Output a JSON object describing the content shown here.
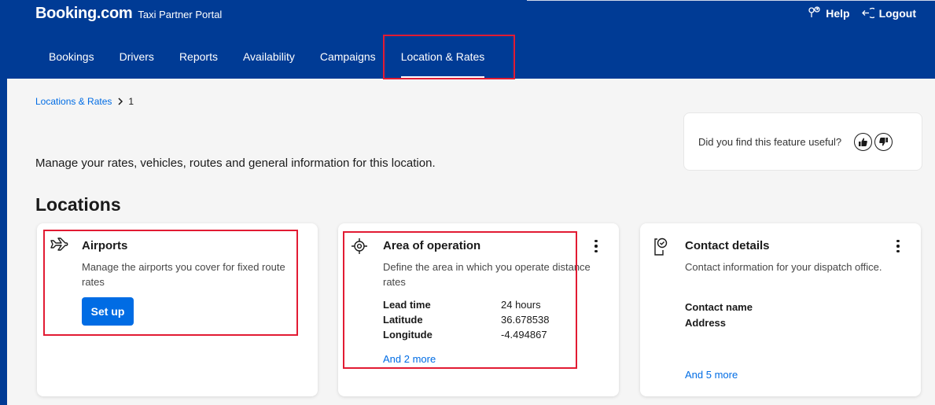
{
  "header": {
    "brand": "Booking.com",
    "portal": "Taxi Partner Portal",
    "help": "Help",
    "logout": "Logout"
  },
  "nav": {
    "tabs": [
      "Bookings",
      "Drivers",
      "Reports",
      "Availability",
      "Campaigns",
      "Location & Rates"
    ],
    "active": "Location & Rates"
  },
  "breadcrumb": {
    "link": "Locations & Rates",
    "current": "1"
  },
  "feedback": {
    "question": "Did you find this feature useful?"
  },
  "intro": "Manage your rates, vehicles, routes and general information for this location.",
  "section_title": "Locations",
  "cards": {
    "airports": {
      "title": "Airports",
      "description": "Manage the airports you cover for fixed route rates",
      "button": "Set up"
    },
    "area": {
      "title": "Area of operation",
      "description": "Define the area in which you operate distance rates",
      "fields": [
        {
          "label": "Lead time",
          "value": "24 hours"
        },
        {
          "label": "Latitude",
          "value": "36.678538"
        },
        {
          "label": "Longitude",
          "value": "-4.494867"
        }
      ],
      "more": "And 2 more"
    },
    "contact": {
      "title": "Contact details",
      "description": "Contact information for your dispatch office.",
      "fields": [
        "Contact name",
        "Address"
      ],
      "more": "And 5 more"
    }
  },
  "colors": {
    "brand_blue": "#003b95",
    "link_blue": "#006ce4",
    "highlight_red": "#e21b33"
  }
}
